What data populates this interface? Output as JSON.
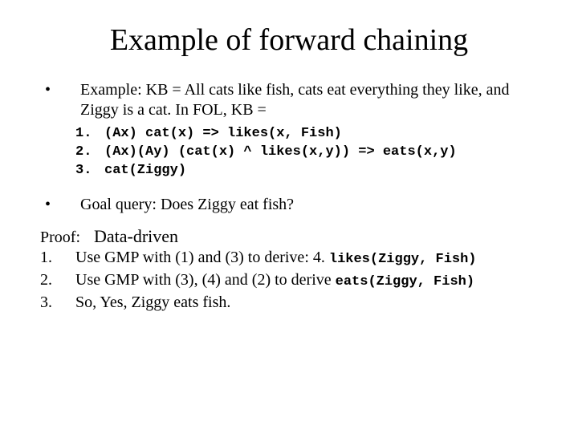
{
  "title": "Example of forward chaining",
  "bullets": [
    {
      "marker": "•",
      "text": "Example: KB = All cats like fish, cats eat everything they like, and Ziggy is a cat. In FOL, KB ="
    },
    {
      "marker": "•",
      "text": "Goal query: Does Ziggy eat fish?"
    }
  ],
  "kb": [
    {
      "n": "1.",
      "rule": "(Ax) cat(x) => likes(x, Fish)"
    },
    {
      "n": "2.",
      "rule": "(Ax)(Ay) (cat(x) ^ likes(x,y)) => eats(x,y)"
    },
    {
      "n": "3.",
      "rule": "cat(Ziggy)"
    }
  ],
  "proof": {
    "label": "Proof:",
    "subtitle": "Data-driven",
    "steps": [
      {
        "n": "1.",
        "pre": "Use GMP with (1) and (3) to derive: 4. ",
        "code": "likes(Ziggy, Fish)"
      },
      {
        "n": "2.",
        "pre": "Use GMP with (3), (4) and (2) to derive ",
        "code": "eats(Ziggy, Fish)"
      },
      {
        "n": "3.",
        "pre": "So, Yes, Ziggy eats fish.",
        "code": ""
      }
    ]
  }
}
